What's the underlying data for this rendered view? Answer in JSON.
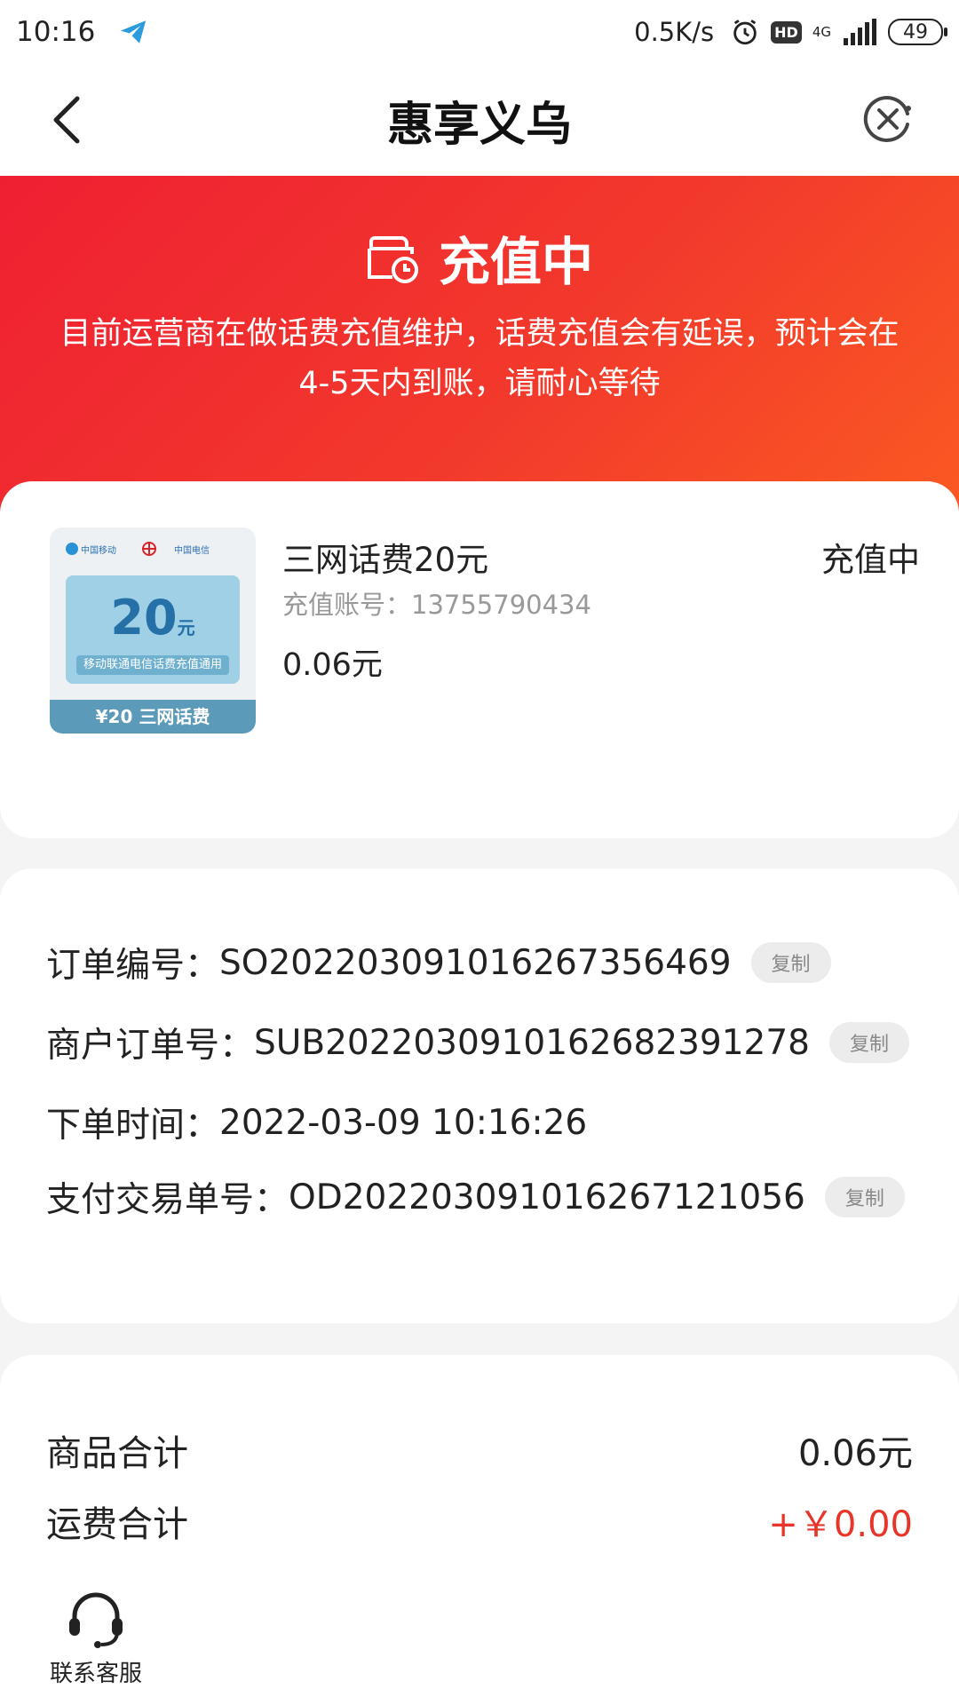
{
  "status_bar": {
    "time": "10:16",
    "net_speed": "0.5K/s",
    "hd": "HD",
    "network": "4G",
    "battery": "49"
  },
  "header": {
    "title": "惠享义乌"
  },
  "banner": {
    "status": "充值中",
    "description": "目前运营商在做话费充值维护，话费充值会有延误，预计会在4-5天内到账，请耐心等待",
    "gradient_colors": [
      "#ef1f32",
      "#fb5a22"
    ]
  },
  "product": {
    "name": "三网话费20元",
    "account": "充值账号：13755790434",
    "price": "0.06元",
    "status": "充值中",
    "thumbnail": {
      "logo_cmcc": "中国移动",
      "logo_ct": "中国电信",
      "amount": "20",
      "amount_unit": "元",
      "tag": "移动联通电信话费充值通用",
      "footer": "¥20 三网话费"
    }
  },
  "order": {
    "rows": [
      {
        "key": "订单编号：",
        "value": "SO2022030910162673564​69",
        "copy": "复制"
      },
      {
        "key": "商户订单号：",
        "value": "SUB2022030910162682391278",
        "copy": "复制"
      },
      {
        "key": "下单时间：",
        "value": "2022-03-09 10:16:26"
      },
      {
        "key": "支付交易单号：",
        "value": "OD2022030910162671​21056",
        "copy": "复制"
      }
    ]
  },
  "summary": {
    "goods_label": "商品合计",
    "goods_value": "0.06元",
    "shipping_label": "运费合计",
    "shipping_value": "+￥0.00",
    "accent_color": "#e8352a"
  },
  "service": {
    "label": "联系客服"
  }
}
